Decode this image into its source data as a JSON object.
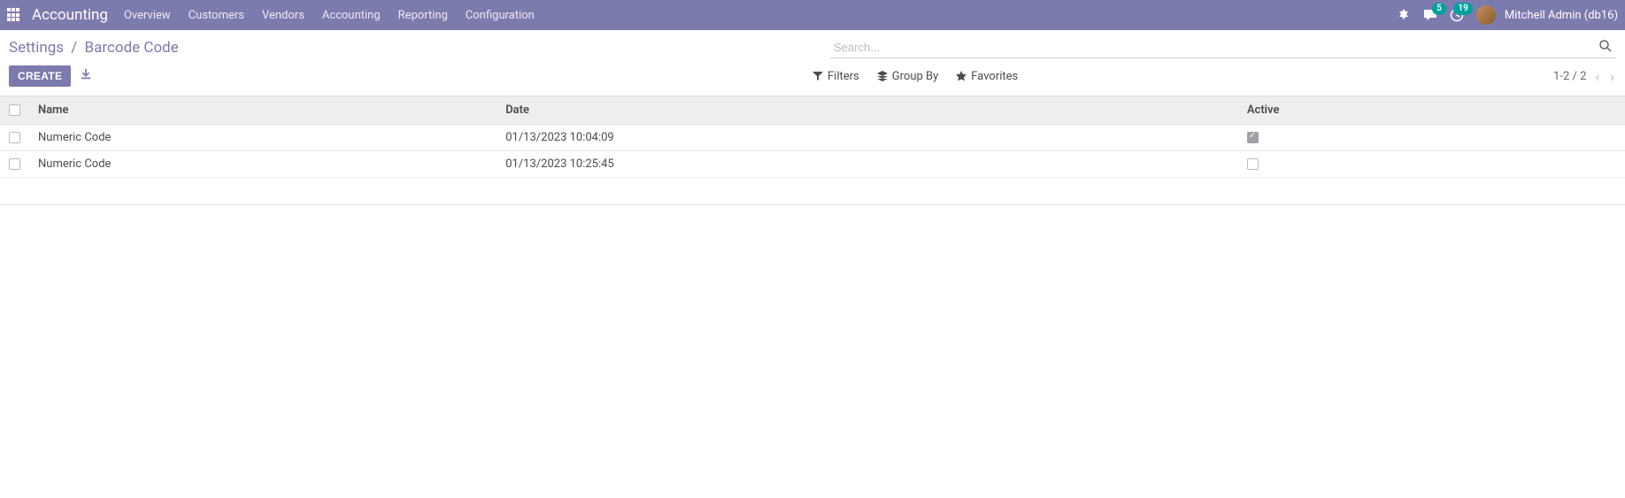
{
  "navbar": {
    "app_name": "Accounting",
    "menu": [
      "Overview",
      "Customers",
      "Vendors",
      "Accounting",
      "Reporting",
      "Configuration"
    ],
    "messages_badge": "5",
    "activities_badge": "19",
    "user_label": "Mitchell Admin (db16)"
  },
  "breadcrumb": {
    "parent": "Settings",
    "current": "Barcode Code"
  },
  "search": {
    "placeholder": "Search..."
  },
  "actions": {
    "create_label": "CREATE"
  },
  "filters": {
    "filters_label": "Filters",
    "groupby_label": "Group By",
    "favorites_label": "Favorites"
  },
  "pager": {
    "range": "1-2 / 2"
  },
  "columns": {
    "name": "Name",
    "date": "Date",
    "active": "Active"
  },
  "rows": [
    {
      "name": "Numeric Code",
      "date": "01/13/2023 10:04:09",
      "active": true
    },
    {
      "name": "Numeric Code",
      "date": "01/13/2023 10:25:45",
      "active": false
    }
  ]
}
